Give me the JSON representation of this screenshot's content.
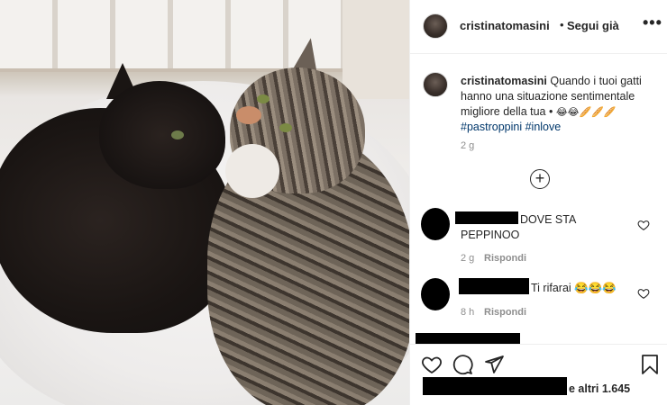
{
  "post": {
    "username": "cristinatomasini",
    "separator": "•",
    "follow_label": "Segui già",
    "more_label": "•••"
  },
  "caption": {
    "username": "cristinatomasini",
    "text": "Quando i tuoi gatti hanno una situazione sentimentale migliore della tua •",
    "emojis": "😂😂🥖🥖🥖",
    "hashtag1": "#pastroppini",
    "hashtag2": "#inlove",
    "time": "2 g"
  },
  "comments": [
    {
      "text": "DOVE STA",
      "text2": "PEPPINOO",
      "time": "2 g",
      "reply": "Rispondi"
    },
    {
      "text": "Ti rifarai 😂😂😂",
      "time": "8 h",
      "reply": "Rispondi"
    }
  ],
  "likes": {
    "text": "e altri 1.645"
  },
  "icons": {
    "heart": "heart-icon",
    "comment": "comment-icon",
    "share": "share-icon",
    "save": "bookmark-icon",
    "add": "plus-circle-icon",
    "more": "more-icon"
  }
}
